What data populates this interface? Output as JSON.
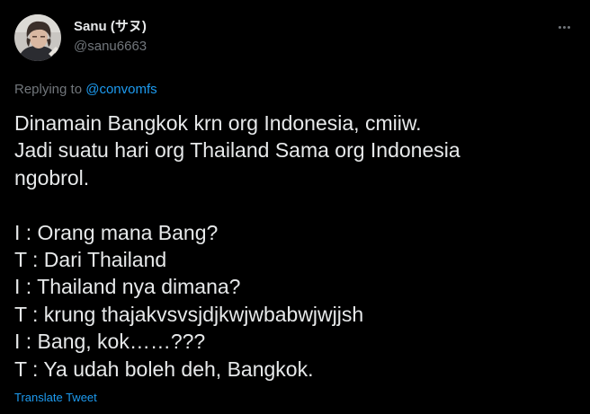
{
  "tweet": {
    "author": {
      "display_name": "Sanu (サヌ)",
      "handle": "@sanu6663",
      "avatar_icon": "profile-photo"
    },
    "more_icon": "more-horizontal-icon",
    "reply_prefix": "Replying to ",
    "reply_mention": "@convomfs",
    "lines": [
      "Dinamain Bangkok krn org Indonesia, cmiiw.",
      "Jadi suatu hari org Thailand Sama org Indonesia",
      "ngobrol.",
      "",
      "I : Orang mana Bang?",
      "T : Dari Thailand",
      "I : Thailand nya dimana?",
      "T : krung thajakvsvsjdjkwjwbabwjwjjsh",
      "I : Bang, kok……???",
      "T : Ya udah boleh deh, Bangkok."
    ],
    "translate_label": "Translate Tweet"
  },
  "colors": {
    "background": "#000000",
    "text_primary": "#e7e9ea",
    "text_secondary": "#71767b",
    "accent": "#1d9bf0"
  }
}
